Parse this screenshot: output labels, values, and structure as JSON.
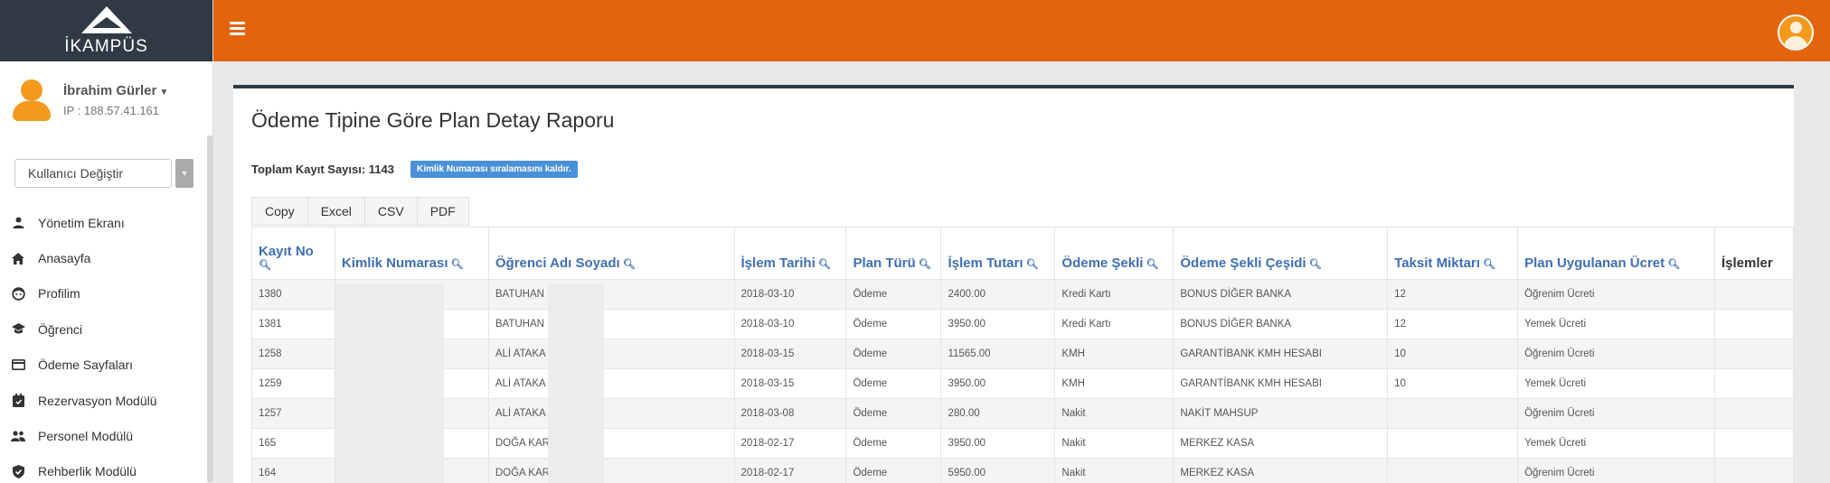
{
  "app": {
    "logo_text": "İKAMPÜS",
    "user_name": "İbrahim Gürler",
    "user_ip": "IP : 188.57.41.161",
    "switch_user": "Kullanıcı Değiştir"
  },
  "menu": [
    {
      "label": "Yönetim Ekranı",
      "icon": "person-icon"
    },
    {
      "label": "Anasayfa",
      "icon": "home-icon"
    },
    {
      "label": "Profilim",
      "icon": "face-icon"
    },
    {
      "label": "Öğrenci",
      "icon": "school-icon"
    },
    {
      "label": "Ödeme Sayfaları",
      "icon": "card-icon"
    },
    {
      "label": "Rezervasyon Modülü",
      "icon": "calendar-icon"
    },
    {
      "label": "Personel Modülü",
      "icon": "people-icon"
    },
    {
      "label": "Rehberlik Modülü",
      "icon": "badge-icon"
    }
  ],
  "page": {
    "title": "Ödeme Tipine Göre Plan Detay Raporu",
    "total_label": "Toplam Kayıt Sayısı: 1143",
    "badge": "Kimlik Numarası sıralamasını kaldır."
  },
  "buttons": {
    "copy": "Copy",
    "excel": "Excel",
    "csv": "CSV",
    "pdf": "PDF"
  },
  "table": {
    "headers": {
      "kayit_no": "Kayıt No",
      "kimlik": "Kimlik Numarası",
      "ad": "Öğrenci Adı Soyadı",
      "tarih": "İşlem Tarihi",
      "plan_turu": "Plan Türü",
      "tutar": "İşlem Tutarı",
      "sekil": "Ödeme Şekli",
      "sekil_cesidi": "Ödeme Şekli Çeşidi",
      "taksit": "Taksit Miktarı",
      "ucret": "Plan Uygulanan Ücret",
      "islemler": "İşlemler"
    },
    "rows": [
      {
        "no": "1380",
        "kimlik": "",
        "ad": "BATUHAN",
        "tarih": "2018-03-10",
        "tur": "Ödeme",
        "tutar": "2400.00",
        "sekil": "Kredi Kartı",
        "cesit": "BONUS DİĞER BANKA",
        "taksit": "12",
        "ucret": "Öğrenim Ücreti"
      },
      {
        "no": "1381",
        "kimlik": "",
        "ad": "BATUHAN",
        "tarih": "2018-03-10",
        "tur": "Ödeme",
        "tutar": "3950.00",
        "sekil": "Kredi Kartı",
        "cesit": "BONUS DİĞER BANKA",
        "taksit": "12",
        "ucret": "Yemek Ücreti"
      },
      {
        "no": "1258",
        "kimlik": "",
        "ad": "ALİ ATAKA",
        "tarih": "2018-03-15",
        "tur": "Ödeme",
        "tutar": "11565.00",
        "sekil": "KMH",
        "cesit": "GARANTİBANK KMH HESABI",
        "taksit": "10",
        "ucret": "Öğrenim Ücreti"
      },
      {
        "no": "1259",
        "kimlik": "",
        "ad": "ALİ ATAKA",
        "tarih": "2018-03-15",
        "tur": "Ödeme",
        "tutar": "3950.00",
        "sekil": "KMH",
        "cesit": "GARANTİBANK KMH HESABI",
        "taksit": "10",
        "ucret": "Yemek Ücreti"
      },
      {
        "no": "1257",
        "kimlik": "",
        "ad": "ALİ ATAKA",
        "tarih": "2018-03-08",
        "tur": "Ödeme",
        "tutar": "280.00",
        "sekil": "Nakit",
        "cesit": "NAKİT MAHSUP",
        "taksit": "",
        "ucret": "Öğrenim Ücreti"
      },
      {
        "no": "165",
        "kimlik": "",
        "ad": "DOĞA KAR",
        "tarih": "2018-02-17",
        "tur": "Ödeme",
        "tutar": "3950.00",
        "sekil": "Nakit",
        "cesit": "MERKEZ KASA",
        "taksit": "",
        "ucret": "Yemek Ücreti"
      },
      {
        "no": "164",
        "kimlik": "",
        "ad": "DOĞA KAR",
        "tarih": "2018-02-17",
        "tur": "Ödeme",
        "tutar": "5950.00",
        "sekil": "Nakit",
        "cesit": "MERKEZ KASA",
        "taksit": "",
        "ucret": "Öğrenim Ücreti"
      }
    ]
  },
  "colors": {
    "topbar": "#e3640c",
    "sidebar_header": "#2f3a45",
    "link": "#3f6fb5",
    "badge": "#4a90d9"
  }
}
